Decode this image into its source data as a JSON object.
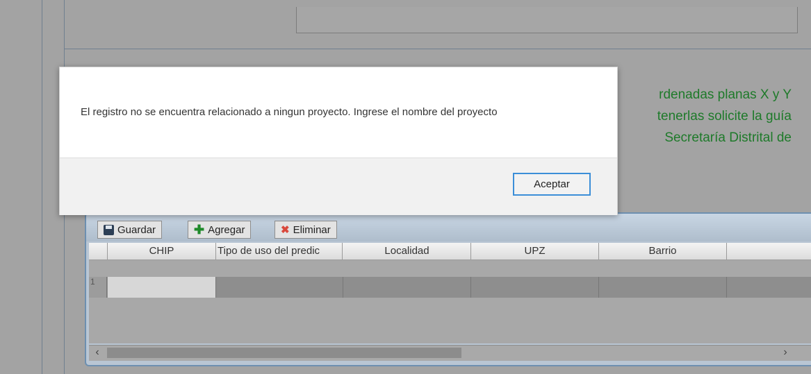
{
  "background_text": {
    "line1": "rdenadas planas X y Y",
    "line2": "tenerlas solicite la guía",
    "line3": "Secretaría Distrital de"
  },
  "grid": {
    "toolbar": {
      "save_label": "Guardar",
      "add_label": "Agregar",
      "delete_label": "Eliminar"
    },
    "columns": [
      "CHIP",
      "Tipo de uso del predic",
      "Localidad",
      "UPZ",
      "Barrio"
    ],
    "rows": [
      {
        "num": "1"
      }
    ],
    "scroll_left": "‹",
    "scroll_right": "›"
  },
  "dialog": {
    "message": "El registro no se encuentra relacionado a ningun proyecto. Ingrese el nombre del proyecto",
    "ok_label": "Aceptar"
  }
}
